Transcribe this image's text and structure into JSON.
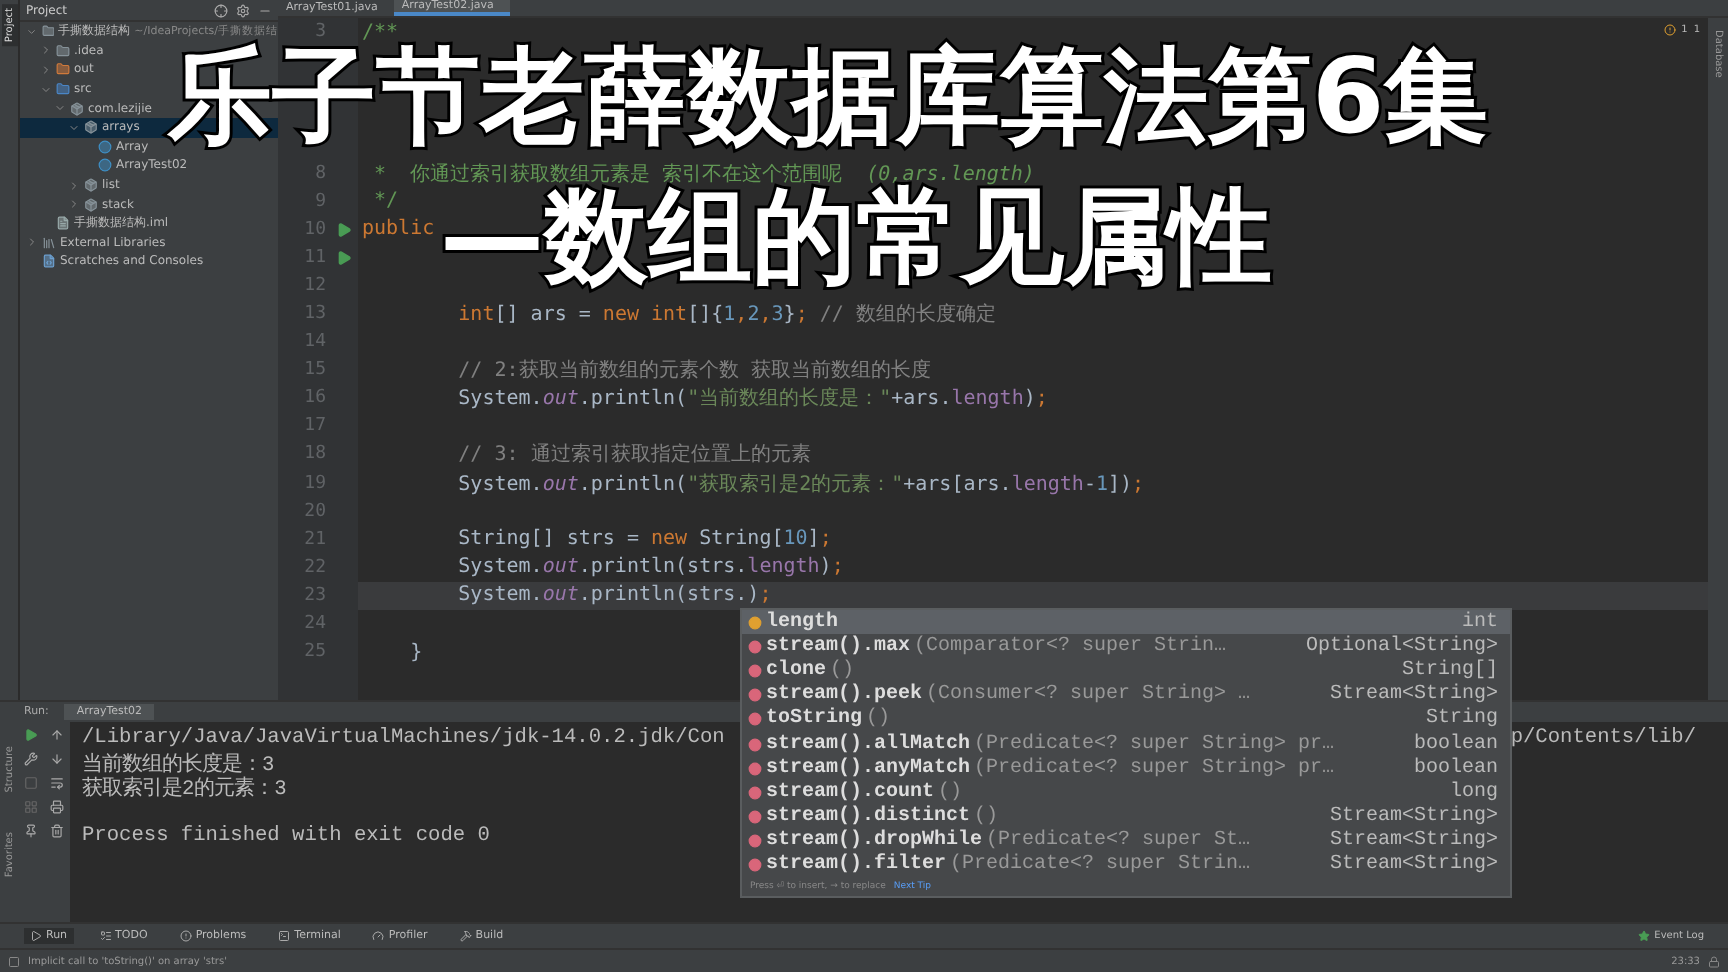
{
  "project_panel": {
    "title": "Project",
    "tree": [
      {
        "name": "手撕数据结构",
        "path": "~/IdeaProjects/手撕数据结",
        "kind": "module",
        "expanded": true,
        "selected": false,
        "children": [
          {
            "name": ".idea",
            "kind": "folder",
            "expanded": false,
            "selected": false
          },
          {
            "name": "out",
            "kind": "output",
            "expanded": false,
            "selected": false
          },
          {
            "name": "src",
            "kind": "source",
            "expanded": true,
            "selected": false,
            "children": [
              {
                "name": "com.lezijie",
                "kind": "package",
                "expanded": true,
                "selected": false,
                "children": [
                  {
                    "name": "arrays",
                    "kind": "package",
                    "expanded": true,
                    "selected": true,
                    "children": [
                      {
                        "name": "Array",
                        "kind": "class",
                        "selected": false
                      },
                      {
                        "name": "ArrayTest02",
                        "kind": "class",
                        "selected": false
                      }
                    ]
                  },
                  {
                    "name": "list",
                    "kind": "package",
                    "expanded": false,
                    "selected": false
                  },
                  {
                    "name": "stack",
                    "kind": "package",
                    "expanded": false,
                    "selected": false
                  }
                ]
              }
            ]
          },
          {
            "name": "手撕数据结构.iml",
            "kind": "file",
            "selected": false
          }
        ]
      },
      {
        "name": "External Libraries",
        "kind": "library",
        "expanded": false,
        "selected": false
      },
      {
        "name": "Scratches and Consoles",
        "kind": "scratch",
        "selected": false
      }
    ]
  },
  "side_tabs": {
    "left_top": "Project",
    "left_bottom": [
      "Structure",
      "Favorites"
    ],
    "right": "Database"
  },
  "editor_tabs": [
    {
      "label": "ArrayTest01.java",
      "selected": false
    },
    {
      "label": "ArrayTest02.java",
      "selected": true
    }
  ],
  "inspections": {
    "warnings": "1",
    "ok": "1"
  },
  "code_lines": [
    {
      "number": "3",
      "run": false,
      "current": false,
      "tokens": [
        {
          "kind": "doc",
          "t": "/**"
        }
      ]
    },
    {
      "run": false,
      "current": false
    },
    {
      "run": false,
      "current": false
    },
    {
      "run": false,
      "current": false
    },
    {
      "run": false,
      "current": false
    },
    {
      "number": "8",
      "run": false,
      "current": false,
      "tokens": [
        {
          "kind": "doc",
          "t": " *  你通过索引获取数组元素是 索引不在这个范围呢  "
        },
        {
          "kind": "doctag",
          "t": "(0,ars.length)"
        }
      ]
    },
    {
      "number": "9",
      "run": false,
      "current": false,
      "tokens": [
        {
          "kind": "doc",
          "t": " */"
        }
      ]
    },
    {
      "number": "10",
      "run": true,
      "current": false,
      "tokens": [
        {
          "kind": "kw",
          "t": "public"
        }
      ]
    },
    {
      "number": "11",
      "run": true,
      "current": false
    },
    {
      "number": "12",
      "run": false,
      "current": false
    },
    {
      "number": "13",
      "run": false,
      "current": false,
      "tokens": [
        {
          "kind": "kw",
          "t": "        int"
        },
        {
          "kind": "plain",
          "t": "[] ars = "
        },
        {
          "kind": "kw",
          "t": "new int"
        },
        {
          "kind": "plain",
          "t": "[]{"
        },
        {
          "kind": "num",
          "t": "1"
        },
        {
          "kind": "kw",
          "t": ","
        },
        {
          "kind": "num",
          "t": "2"
        },
        {
          "kind": "kw",
          "t": ","
        },
        {
          "kind": "num",
          "t": "3"
        },
        {
          "kind": "plain",
          "t": "}"
        },
        {
          "kind": "kw",
          "t": ";"
        },
        {
          "kind": "com",
          "t": " // 数组的长度确定"
        }
      ]
    },
    {
      "number": "14",
      "run": false,
      "current": false
    },
    {
      "number": "15",
      "run": false,
      "current": false,
      "tokens": [
        {
          "kind": "com",
          "t": "        // 2:获取当前数组的元素个数 获取当前数组的长度"
        }
      ]
    },
    {
      "number": "16",
      "run": false,
      "current": false,
      "tokens": [
        {
          "kind": "plain",
          "t": "        System."
        },
        {
          "kind": "static",
          "t": "out"
        },
        {
          "kind": "plain",
          "t": ".println("
        },
        {
          "kind": "str",
          "t": "\"当前数组的长度是：\""
        },
        {
          "kind": "plain",
          "t": "+ars."
        },
        {
          "kind": "field",
          "t": "length"
        },
        {
          "kind": "plain",
          "t": ")"
        },
        {
          "kind": "kw",
          "t": ";"
        }
      ]
    },
    {
      "number": "17",
      "run": false,
      "current": false
    },
    {
      "number": "18",
      "run": false,
      "current": false,
      "tokens": [
        {
          "kind": "com",
          "t": "        // 3: 通过索引获取指定位置上的元素"
        }
      ]
    },
    {
      "number": "19",
      "run": false,
      "current": false,
      "tokens": [
        {
          "kind": "plain",
          "t": "        System."
        },
        {
          "kind": "static",
          "t": "out"
        },
        {
          "kind": "plain",
          "t": ".println("
        },
        {
          "kind": "str",
          "t": "\"获取索引是2的元素：\""
        },
        {
          "kind": "plain",
          "t": "+ars[ars."
        },
        {
          "kind": "field",
          "t": "length"
        },
        {
          "kind": "plain",
          "t": "-"
        },
        {
          "kind": "num",
          "t": "1"
        },
        {
          "kind": "plain",
          "t": "])"
        },
        {
          "kind": "kw",
          "t": ";"
        }
      ]
    },
    {
      "number": "20",
      "run": false,
      "current": false
    },
    {
      "number": "21",
      "run": false,
      "current": false,
      "tokens": [
        {
          "kind": "plain",
          "t": "        String[] strs = "
        },
        {
          "kind": "kw",
          "t": "new "
        },
        {
          "kind": "plain",
          "t": "String["
        },
        {
          "kind": "num",
          "t": "10"
        },
        {
          "kind": "plain",
          "t": "]"
        },
        {
          "kind": "kw",
          "t": ";"
        }
      ]
    },
    {
      "number": "22",
      "run": false,
      "current": false,
      "tokens": [
        {
          "kind": "plain",
          "t": "        System."
        },
        {
          "kind": "static",
          "t": "out"
        },
        {
          "kind": "plain",
          "t": ".println(strs."
        },
        {
          "kind": "field",
          "t": "length"
        },
        {
          "kind": "plain",
          "t": ")"
        },
        {
          "kind": "kw",
          "t": ";"
        }
      ]
    },
    {
      "number": "23",
      "run": false,
      "current": true,
      "tokens": [
        {
          "kind": "plain",
          "t": "        System."
        },
        {
          "kind": "static",
          "t": "out"
        },
        {
          "kind": "plain",
          "t": ".println(strs.)"
        },
        {
          "kind": "kw",
          "t": ";"
        }
      ]
    },
    {
      "number": "24",
      "run": false,
      "current": false
    },
    {
      "number": "25",
      "run": false,
      "current": false,
      "tokens": [
        {
          "kind": "plain",
          "t": "    }"
        }
      ]
    }
  ],
  "completion": {
    "items": [
      {
        "kind": "field",
        "name": "length",
        "type": "int",
        "selected": true
      },
      {
        "kind": "method",
        "name": "stream().max",
        "params": "(Comparator<? super Strin…",
        "type": "Optional<String>",
        "selected": false
      },
      {
        "kind": "method",
        "name": "clone",
        "params": "()",
        "type": "String[]",
        "selected": false
      },
      {
        "kind": "method",
        "name": "stream().peek",
        "params": "(Consumer<? super String> …",
        "type": "Stream<String>",
        "selected": false
      },
      {
        "kind": "method",
        "name": "toString",
        "params": "()",
        "type": "String",
        "selected": false
      },
      {
        "kind": "method",
        "name": "stream().allMatch",
        "params": "(Predicate<? super String> pr…",
        "type": "boolean",
        "selected": false
      },
      {
        "kind": "method",
        "name": "stream().anyMatch",
        "params": "(Predicate<? super String> pr…",
        "type": "boolean",
        "selected": false
      },
      {
        "kind": "method",
        "name": "stream().count",
        "params": "()",
        "type": "long",
        "selected": false
      },
      {
        "kind": "method",
        "name": "stream().distinct",
        "params": "()",
        "type": "Stream<String>",
        "selected": false
      },
      {
        "kind": "method",
        "name": "stream().dropWhile",
        "params": "(Predicate<? super St…",
        "type": "Stream<String>",
        "selected": false
      },
      {
        "kind": "method",
        "name": "stream().filter",
        "params": "(Predicate<? super Strin…",
        "type": "Stream<String>",
        "selected": false
      }
    ],
    "hint": "Press ⏎ to insert, → to replace",
    "tip_link": "Next Tip"
  },
  "run_panel": {
    "label": "Run:",
    "tab": "ArrayTest02",
    "output": [
      {
        "kind": "command",
        "text": "/Library/Java/JavaVirtualMachines/jdk-14.0.2.jdk/Con",
        "tail": "p/Contents/lib/"
      },
      {
        "kind": "out",
        "text": "当前数组的长度是：3"
      },
      {
        "kind": "out",
        "text": "获取索引是2的元素：3"
      },
      {
        "kind": "blank"
      },
      {
        "kind": "out",
        "text": "Process finished with exit code 0"
      }
    ]
  },
  "tool_tabs": [
    {
      "label": "Run",
      "kind": "play",
      "selected": true
    },
    {
      "label": "TODO",
      "kind": "list",
      "selected": false
    },
    {
      "label": "Problems",
      "kind": "alert",
      "selected": false
    },
    {
      "label": "Terminal",
      "kind": "terminal",
      "selected": false
    },
    {
      "label": "Profiler",
      "kind": "gauge",
      "selected": false
    },
    {
      "label": "Build",
      "kind": "hammer",
      "selected": false
    }
  ],
  "event_log": "Event Log",
  "status_bar": {
    "message": "Implicit call to 'toString()' on array 'strs'",
    "position": "23:33"
  },
  "overlay_title": [
    "乐子节老薛数据库算法第6集",
    "—数组的常见属性"
  ]
}
